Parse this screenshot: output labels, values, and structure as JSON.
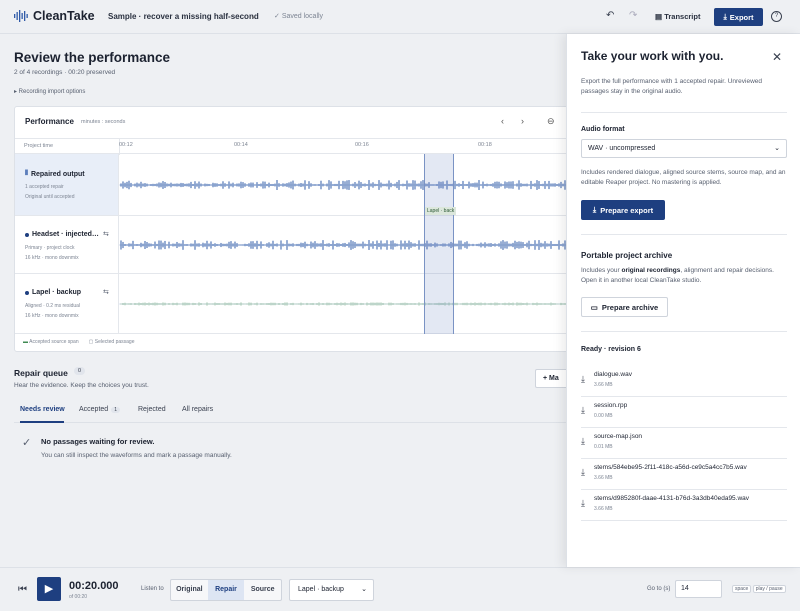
{
  "app": {
    "name": "CleanTake",
    "project_name": "Sample · recover a missing half-second",
    "save_status": "Saved locally",
    "transcript_label": "Transcript",
    "export_label": "Export"
  },
  "page": {
    "title": "Review the performance",
    "subtitle": "2 of 4 recordings · 00:20 preserved",
    "import_toggle": "▸ Recording import options"
  },
  "performance": {
    "title": "Performance",
    "unit": "minutes : seconds",
    "project_time_label": "Project time",
    "ticks": [
      "00:12",
      "00:14",
      "00:16",
      "00:18"
    ],
    "tracks": [
      {
        "name": "Repaired output",
        "meta1": "1 accepted repair",
        "meta2": "Original until accepted"
      },
      {
        "name": "Headset · injected…",
        "meta1": "Primary · project clock",
        "meta2": "16 kHz · mono downmix"
      },
      {
        "name": "Lapel · backup",
        "meta1": "Aligned · 0.2 ms residual",
        "meta2": "16 kHz · mono downmix"
      }
    ],
    "selection_label": "Lapel · back",
    "legend_accepted": "Accepted source span",
    "legend_selected": "Selected passage"
  },
  "repair_queue": {
    "title": "Repair queue",
    "count": "0",
    "subtitle": "Hear the evidence. Keep the choices you trust.",
    "action_label": "+ Ma",
    "tabs": [
      {
        "label": "Needs review"
      },
      {
        "label": "Accepted",
        "badge": "1"
      },
      {
        "label": "Rejected"
      },
      {
        "label": "All repairs"
      }
    ],
    "empty_title": "No passages waiting for review.",
    "empty_sub": "You can still inspect the waveforms and mark a passage manually."
  },
  "transport": {
    "time": "00:20.000",
    "duration": "of 00:20",
    "listen_label": "Listen to",
    "modes": [
      "Original",
      "Repair",
      "Source"
    ],
    "active_mode": "Repair",
    "source_select": "Lapel · backup",
    "goto_label": "Go to (s)",
    "goto_value": "14",
    "kbd_key": "space",
    "kbd_hint": "play / pause"
  },
  "drawer": {
    "title": "Take your work with you.",
    "intro": "Export the full performance with 1 accepted repair. Unreviewed passages stay in the original audio.",
    "format_label": "Audio format",
    "format_value": "WAV · uncompressed",
    "format_desc": "Includes rendered dialogue, aligned source stems, source map, and an editable Reaper project. No mastering is applied.",
    "prepare_export": "Prepare export",
    "archive_title": "Portable project archive",
    "archive_desc_1": "Includes your ",
    "archive_desc_bold": "original recordings",
    "archive_desc_2": ", alignment and repair decisions. Open it in another local CleanTake studio.",
    "prepare_archive": "Prepare archive",
    "ready_label": "Ready · revision 6",
    "files": [
      {
        "name": "dialogue.wav",
        "size": "3.66 MB"
      },
      {
        "name": "session.rpp",
        "size": "0.00 MB"
      },
      {
        "name": "source-map.json",
        "size": "0.01 MB"
      },
      {
        "name": "stems/584ebe95-2f11-418c-a56d-ce9c5a4cc7b5.wav",
        "size": "3.66 MB"
      },
      {
        "name": "stems/d985280f-daae-4131-b76d-3a3db40eda95.wav",
        "size": "3.66 MB"
      }
    ]
  },
  "colors": {
    "accent": "#1e3f80",
    "waveform": "#2f5aa8",
    "waveform_faint": "#b8c7e2",
    "accepted": "#3f8a52"
  }
}
